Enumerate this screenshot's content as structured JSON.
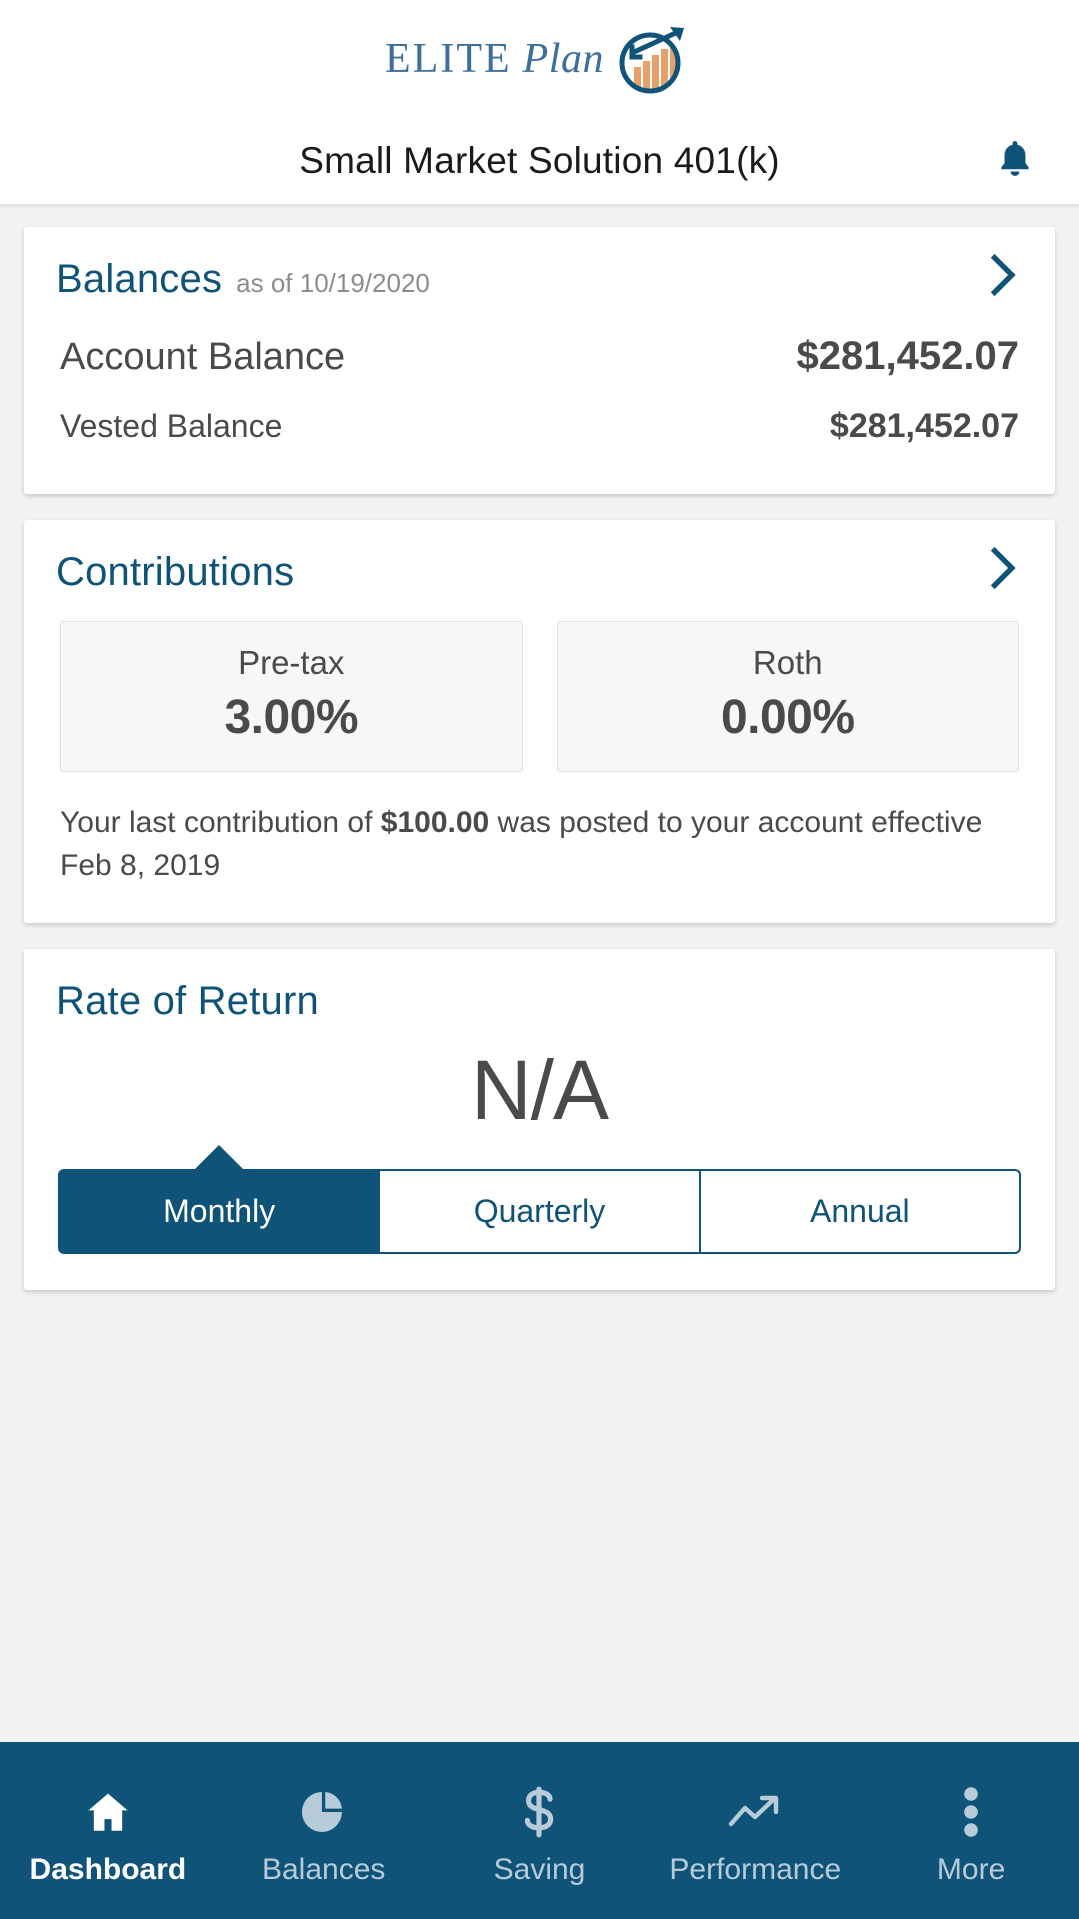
{
  "header": {
    "brand_elite": "ELITE",
    "brand_plan": "Plan",
    "logo_icon": "elite-plan-chart-circle-logo",
    "plan_title": "Small Market Solution 401(k)",
    "bell_icon": "notification-bell-icon"
  },
  "balances_card": {
    "title": "Balances",
    "subtitle": "as of 10/19/2020",
    "chevron_icon": "chevron-right-icon",
    "rows": [
      {
        "label": "Account Balance",
        "value": "$281,452.07"
      },
      {
        "label": "Vested Balance",
        "value": "$281,452.07"
      }
    ]
  },
  "contributions_card": {
    "title": "Contributions",
    "chevron_icon": "chevron-right-icon",
    "tiles": [
      {
        "label": "Pre-tax",
        "value": "3.00%"
      },
      {
        "label": "Roth",
        "value": "0.00%"
      }
    ],
    "note_prefix": "Your last contribution of ",
    "note_amount": "$100.00",
    "note_suffix": " was posted to your account effective Feb 8, 2019"
  },
  "rate_of_return_card": {
    "title": "Rate of Return",
    "value": "N/A",
    "segments": [
      {
        "label": "Monthly",
        "active": true
      },
      {
        "label": "Quarterly",
        "active": false
      },
      {
        "label": "Annual",
        "active": false
      }
    ]
  },
  "bottom_nav": {
    "items": [
      {
        "label": "Dashboard",
        "icon": "home-icon",
        "active": true
      },
      {
        "label": "Balances",
        "icon": "pie-chart-icon",
        "active": false
      },
      {
        "label": "Saving",
        "icon": "dollar-sign-icon",
        "active": false
      },
      {
        "label": "Performance",
        "icon": "trending-up-icon",
        "active": false
      },
      {
        "label": "More",
        "icon": "overflow-dots-icon",
        "active": false
      }
    ]
  },
  "colors": {
    "brand_blue": "#0f5378",
    "wordmark_blue": "#3d6e9e",
    "logo_orange": "#e8a06a",
    "page_bg": "#f2f2f2",
    "nav_inactive": "#b7cbd9"
  }
}
